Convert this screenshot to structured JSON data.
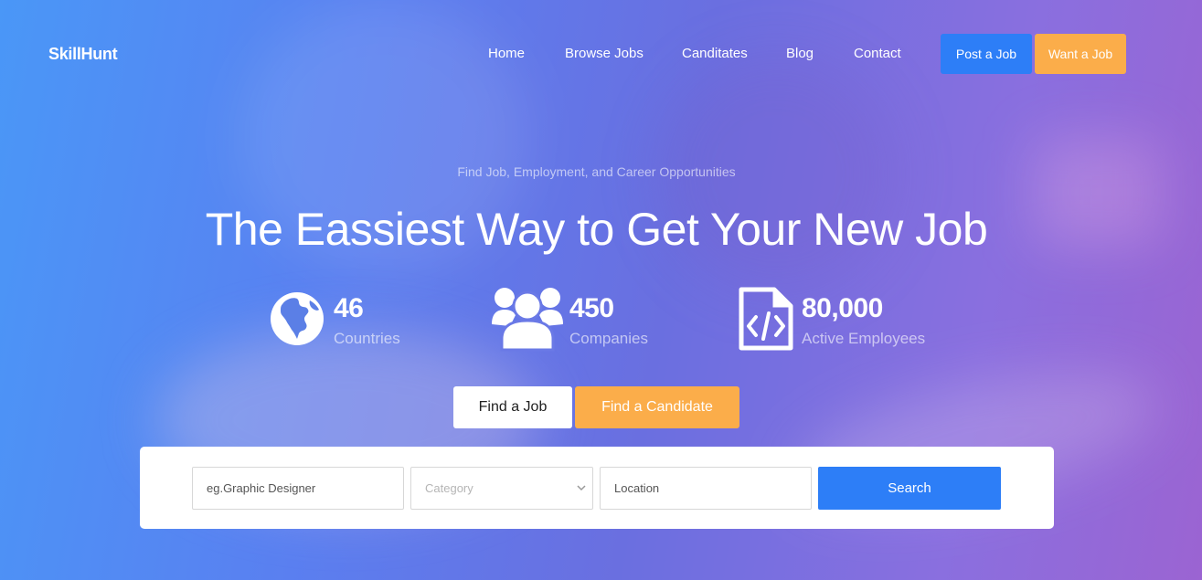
{
  "brand": {
    "name": "SkillHunt"
  },
  "nav": {
    "items": [
      {
        "label": "Home"
      },
      {
        "label": "Browse Jobs"
      },
      {
        "label": "Canditates"
      },
      {
        "label": "Blog"
      },
      {
        "label": "Contact"
      }
    ],
    "post_job_label": "Post a Job",
    "want_job_label": "Want a Job"
  },
  "hero": {
    "tagline": "Find Job, Employment, and Career Opportunities",
    "headline": "The Eassiest Way to Get Your New Job"
  },
  "stats": [
    {
      "icon": "globe-icon",
      "value": "46",
      "label": "Countries"
    },
    {
      "icon": "users-icon",
      "value": "450",
      "label": "Companies"
    },
    {
      "icon": "code-file-icon",
      "value": "80,000",
      "label": "Active Employees"
    }
  ],
  "tabs": {
    "find_job": "Find a Job",
    "find_candidate": "Find a Candidate"
  },
  "search": {
    "keyword_placeholder": "eg.Graphic Designer",
    "category_selected": "Category",
    "location_placeholder": "Location",
    "button_label": "Search"
  },
  "colors": {
    "primary": "#2d7ef7",
    "accent": "#fbad4a",
    "white": "#ffffff"
  }
}
